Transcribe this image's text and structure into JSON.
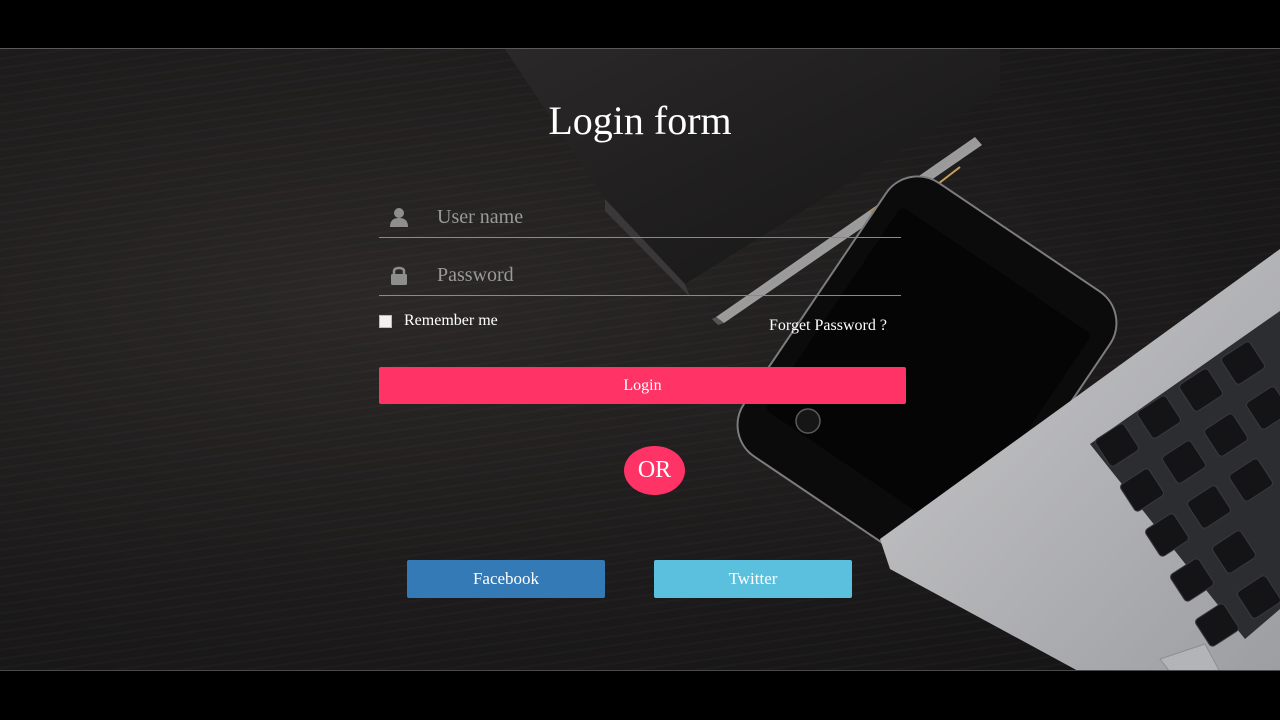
{
  "form": {
    "title": "Login form",
    "username": {
      "placeholder": "User name",
      "icon": "user-icon"
    },
    "password": {
      "placeholder": "Password",
      "icon": "lock-icon"
    },
    "remember_label": "Remember me",
    "forget_label": "Forget Password ?",
    "login_label": "Login",
    "or_label": "OR"
  },
  "social": {
    "facebook_label": "Facebook",
    "twitter_label": "Twitter"
  },
  "colors": {
    "accent": "#ff3366",
    "facebook": "#337ab7",
    "twitter": "#5bc0de"
  }
}
